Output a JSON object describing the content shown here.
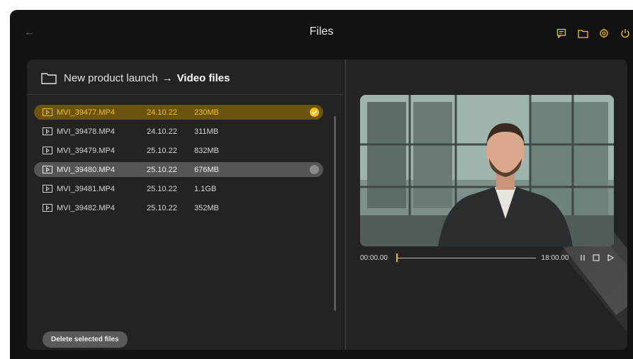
{
  "header": {
    "title": "Files",
    "back_icon": "arrow-left-icon",
    "icons": [
      "chat-icon",
      "folder-icon",
      "settings-icon",
      "power-icon"
    ],
    "accent_color": "#f4c01e"
  },
  "breadcrumb": {
    "parent": "New product launch",
    "separator": "→",
    "current": "Video files"
  },
  "files": [
    {
      "name": "MVI_39477.MP4",
      "date": "24.10.22",
      "size": "230MB",
      "state": "selected"
    },
    {
      "name": "MVI_39478.MP4",
      "date": "24.10.22",
      "size": "311MB",
      "state": "normal"
    },
    {
      "name": "MVI_39479.MP4",
      "date": "25.10.22",
      "size": "832MB",
      "state": "normal"
    },
    {
      "name": "MVI_39480.MP4",
      "date": "25.10.22",
      "size": "676MB",
      "state": "hovered"
    },
    {
      "name": "MVI_39481.MP4",
      "date": "25.10.22",
      "size": "1.1GB",
      "state": "normal"
    },
    {
      "name": "MVI_39482.MP4",
      "date": "25.10.22",
      "size": "352MB",
      "state": "normal"
    }
  ],
  "actions": {
    "delete_label": "Delete selected files"
  },
  "player": {
    "time_current": "00:00.00",
    "time_total": "18:00.00",
    "progress": 0,
    "controls": [
      "pause-icon",
      "stop-icon",
      "play-icon"
    ]
  }
}
